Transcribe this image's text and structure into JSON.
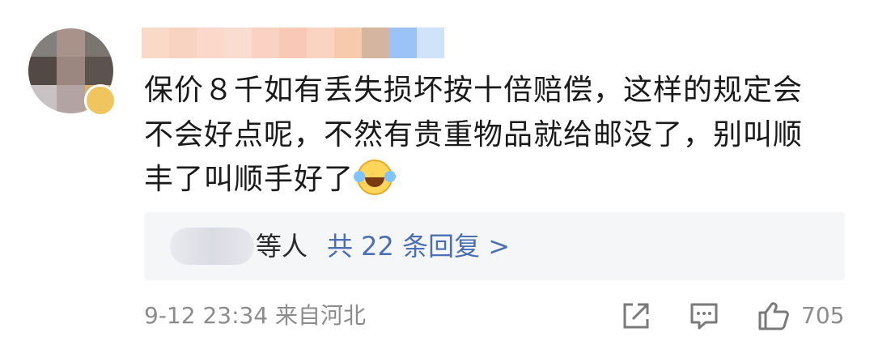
{
  "avatar": {
    "pixel_colors": [
      "#827f7c",
      "#a89289",
      "#7b7570",
      "#534944",
      "#9c8780",
      "#5c524e",
      "#c9c2c5",
      "#b3a3a2",
      "#d6b16a"
    ]
  },
  "username_blur_colors": [
    "#fbd9c8",
    "#f9d3c2",
    "#fbd8c9",
    "#fbdcd1",
    "#f9d2c3",
    "#f9c9b5",
    "#fad3c3",
    "#f7c9ad",
    "#d4b6a0",
    "#9cc3f8",
    "#cfe3fb"
  ],
  "comment": {
    "line1": "保价８千如有丢失损坏按十倍赔偿，这样的规定会",
    "line2": "不会好点呢，不然有贵重物品就给邮没了，别叫顺",
    "line3": "丰了叫顺手好了",
    "emoji": "laughing-crying-emoji"
  },
  "replies": {
    "suffix": "等人",
    "link_text": "共 22 条回复 >"
  },
  "meta": {
    "timestamp_location": "9-12 23:34 来自河北"
  },
  "actions": {
    "like_count": "705",
    "icons": [
      "share-icon",
      "comment-icon",
      "like-icon"
    ]
  },
  "colors": {
    "link": "#4a6fb5",
    "meta": "#8c8c8c",
    "reply_bg": "#f5f6f8"
  }
}
